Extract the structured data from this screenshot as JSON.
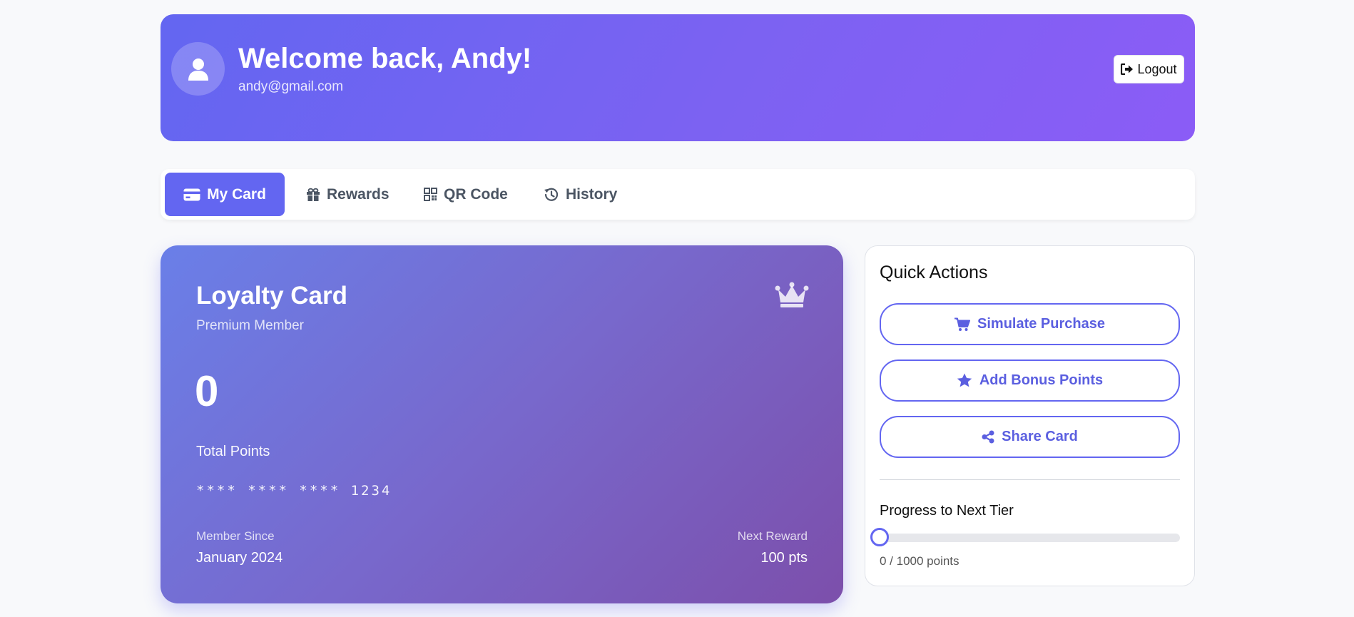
{
  "header": {
    "welcome": "Welcome back, Andy!",
    "email": "andy@gmail.com",
    "logout_label": "Logout",
    "gradient": [
      "#6366f1",
      "#8b5cf6"
    ]
  },
  "tabs": [
    {
      "label": "My Card",
      "icon": "credit-card-icon",
      "active": true
    },
    {
      "label": "Rewards",
      "icon": "gift-icon",
      "active": false
    },
    {
      "label": "QR Code",
      "icon": "qrcode-icon",
      "active": false
    },
    {
      "label": "History",
      "icon": "history-icon",
      "active": false
    }
  ],
  "card": {
    "title": "Loyalty Card",
    "subtitle": "Premium Member",
    "points": "0",
    "points_label": "Total Points",
    "number": "**** **** **** 1234",
    "member_since_label": "Member Since",
    "member_since_value": "January 2024",
    "next_reward_label": "Next Reward",
    "next_reward_value": "100 pts",
    "icon": "crown-icon"
  },
  "quick_actions": {
    "title": "Quick Actions",
    "actions": [
      {
        "label": "Simulate Purchase",
        "icon": "cart-icon"
      },
      {
        "label": "Add Bonus Points",
        "icon": "star-icon"
      },
      {
        "label": "Share Card",
        "icon": "share-icon"
      }
    ],
    "progress_title": "Progress to Next Tier",
    "progress_text": "0 / 1000 points",
    "progress_value": 0
  },
  "colors": {
    "accent": "#6366f1",
    "background": "#f8f9fb"
  }
}
